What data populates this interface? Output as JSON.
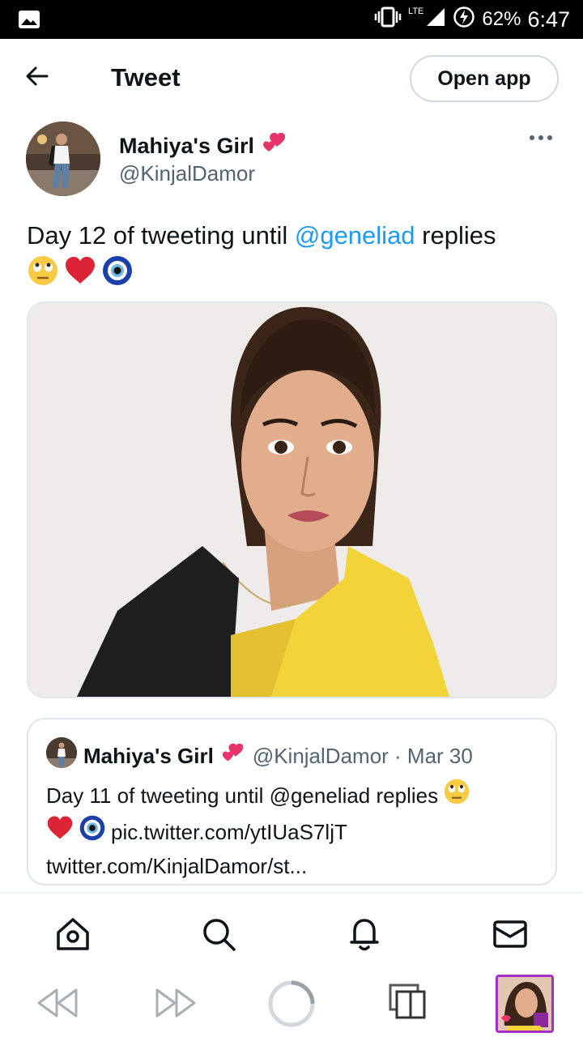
{
  "status_bar": {
    "network": "LTE",
    "battery": "62%",
    "time": "6:47"
  },
  "header": {
    "title": "Tweet",
    "open_app_label": "Open app"
  },
  "tweet": {
    "author_name": "Mahiya's Girl",
    "author_handle": "@KinjalDamor",
    "text_before": "Day 12 of tweeting until ",
    "mention": "@geneliad",
    "text_after": " replies"
  },
  "quote": {
    "author_name": "Mahiya's Girl",
    "meta": "@KinjalDamor · Mar 30",
    "line1": "Day 11 of tweeting until @geneliad replies",
    "link1": "pic.twitter.com/ytIUaS7ljT",
    "link2": "twitter.com/KinjalDamor/st..."
  },
  "nav": {
    "tabs": [
      "home-icon",
      "search-icon",
      "bell-icon",
      "mail-icon"
    ]
  },
  "colors": {
    "link": "#1d9bf0",
    "secondary_text": "#536471",
    "border": "#cfd9de"
  }
}
